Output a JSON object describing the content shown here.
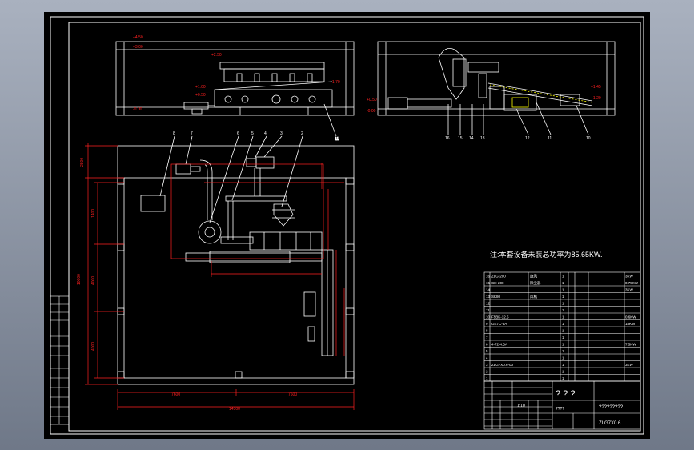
{
  "note": "注:本套设备未装总功率为85.65KW.",
  "title_block": {
    "question_marks": "? ? ?",
    "drawing_name": "?????????",
    "drawing_number": "ZLG7X0.6",
    "cell_a": "????",
    "cell_b": "1:10"
  },
  "parts_list": [
    {
      "no": "16",
      "code": "ZLG-200",
      "name": "旋风",
      "qty": "1",
      "power": "3KW"
    },
    {
      "no": "15",
      "code": "CH-200",
      "name": "除尘器",
      "qty": "1",
      "power": "0.75KW"
    },
    {
      "no": "14",
      "code": "",
      "name": "",
      "qty": "1",
      "power": "3KW"
    },
    {
      "no": "13",
      "code": "SK80",
      "name": "风机",
      "qty": "1",
      "power": ""
    },
    {
      "no": "12",
      "code": "",
      "name": "",
      "qty": "1",
      "power": ""
    },
    {
      "no": "11",
      "code": "",
      "name": "",
      "qty": "1",
      "power": ""
    },
    {
      "no": "10",
      "code": "F5BK-12.5",
      "name": "",
      "qty": "1",
      "power": "0.6KW"
    },
    {
      "no": "9",
      "code": "GE7C-5A",
      "name": "",
      "qty": "1",
      "power": "18KW"
    },
    {
      "no": "8",
      "code": "",
      "name": "",
      "qty": "1",
      "power": ""
    },
    {
      "no": "7",
      "code": "",
      "name": "",
      "qty": "1",
      "power": ""
    },
    {
      "no": "6",
      "code": "4-72-4.5A",
      "name": "",
      "qty": "1",
      "power": "7.5KW"
    },
    {
      "no": "5",
      "code": "",
      "name": "",
      "qty": "1",
      "power": ""
    },
    {
      "no": "4",
      "code": "",
      "name": "",
      "qty": "1",
      "power": ""
    },
    {
      "no": "3",
      "code": "ZLG7X0.6-00",
      "name": "",
      "qty": "1",
      "power": "3KW"
    },
    {
      "no": "2",
      "code": "",
      "name": "",
      "qty": "1",
      "power": ""
    },
    {
      "no": "1",
      "code": "",
      "name": "",
      "qty": "1",
      "power": ""
    }
  ],
  "dimensions": {
    "left_total": "10000",
    "left_top": "2800",
    "left_a": "1400",
    "left_b": "4000",
    "left_c": "4000",
    "bottom_a": "7600",
    "bottom_b": "7600",
    "bottom_total": "14500",
    "elev_a": "+4.50",
    "elev_b": "+3.00",
    "elev_c": "+2.50",
    "elev_d": "+1.70",
    "elev_e": "+1.00",
    "elev_f": "+0.50",
    "elev_g": "-0.00",
    "elev_h": "+1.45",
    "elev_i": "+1.20"
  },
  "colors": {
    "frame": "#ffffff",
    "dimension": "#ff2020",
    "equipment": "#ffffff",
    "leader": "#ffff00",
    "text": "#ffffff",
    "sheet_bg": "#000000"
  }
}
